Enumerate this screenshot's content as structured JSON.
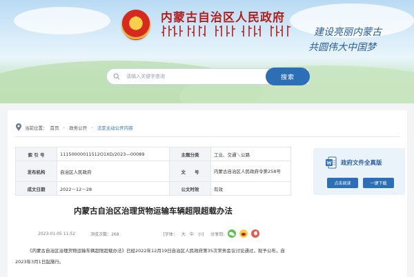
{
  "header": {
    "site_title": "内蒙古自治区人民政府",
    "slogan_line1": "建设亮丽内蒙古",
    "slogan_line2": "共圆伟大中国梦",
    "search_placeholder": "请输入关键字查询",
    "search_button": "搜索"
  },
  "breadcrumb": {
    "current_label": "当前位置：",
    "items": [
      "首页",
      "政务公开",
      "法定主动公开内容"
    ]
  },
  "meta": {
    "index_label": "索 引 号",
    "index_value": "11150000011512O1XD/2023—00089",
    "topic_label": "主题分类",
    "topic_value": "工业、交通＼公路",
    "issuer_label": "发布机构",
    "issuer_value": "自治区人民政府",
    "docno_label": "文　　号",
    "docno_value": "内蒙古自治区人民政府令第258号",
    "date_label": "成文日期",
    "date_value": "2022－12－28",
    "validity_label": "公文时效",
    "validity_value": "有效"
  },
  "document": {
    "title": "内蒙古自治区治理货物运输车辆超限超载办法",
    "publish_time": "2023-01-05 11:52",
    "views": "浏览次数：268",
    "font_label": "[字体：",
    "font_large": "大",
    "font_medium": "中",
    "font_small": "小]",
    "share_label": "分享到:",
    "body": "《内蒙古自治区治理货物运输车辆超限超载办法》已经2022年12月19日自治区人民政府第35次常务会议讨论通过，现予公布，自2023年3月1日起施行。"
  },
  "card": {
    "title": "政府文件全真版",
    "read_button": "点击阅读",
    "download_button": "一键下载"
  },
  "colors": {
    "brand_red": "#b11d1a",
    "primary_blue": "#2c6fb7"
  }
}
